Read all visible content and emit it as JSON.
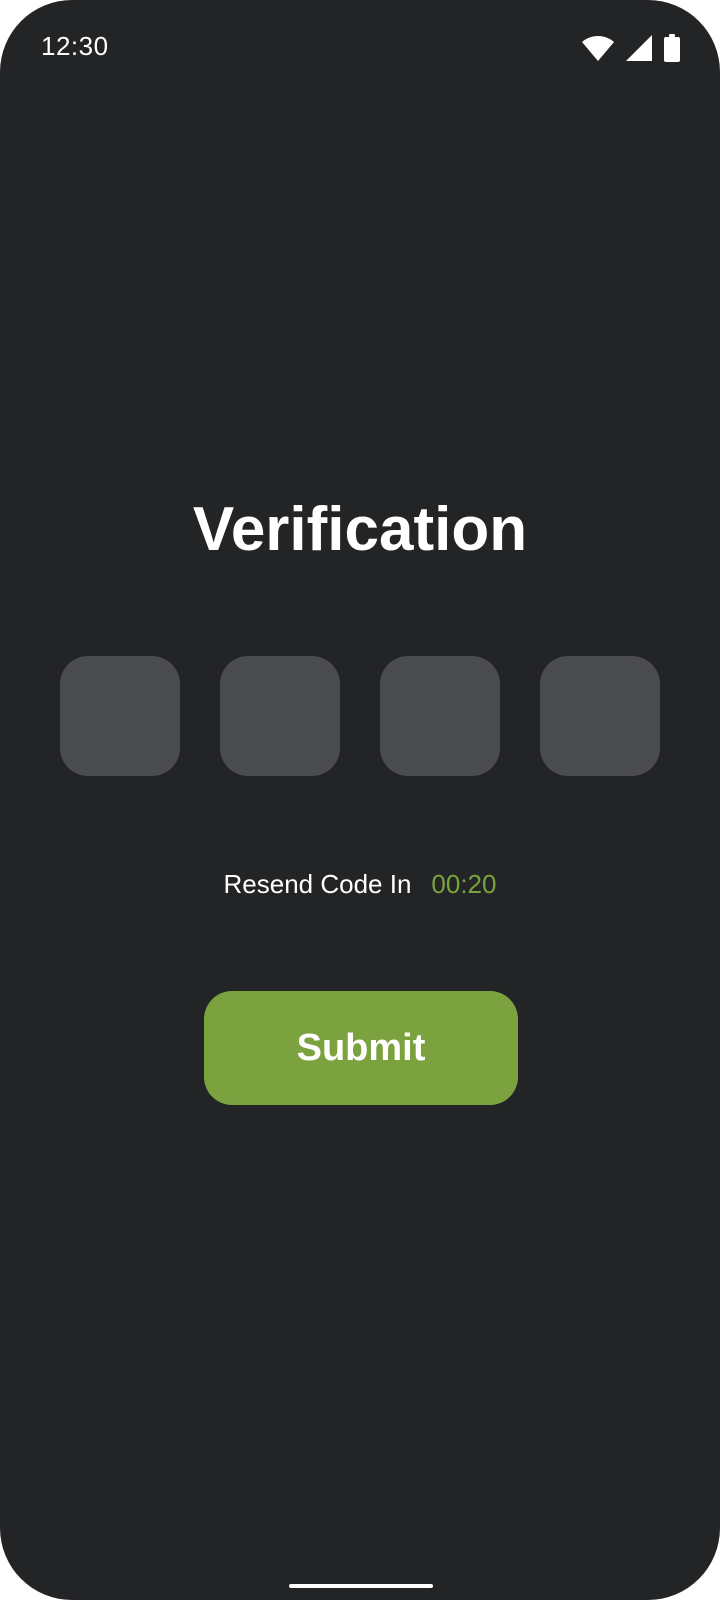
{
  "status_bar": {
    "time": "12:30",
    "icons": [
      "wifi-icon",
      "cellular-signal-icon",
      "battery-icon"
    ]
  },
  "verification": {
    "title": "Verification",
    "code_boxes": [
      "",
      "",
      "",
      ""
    ],
    "resend_label": "Resend Code In",
    "resend_timer": "00:20",
    "submit_label": "Submit"
  },
  "colors": {
    "background": "#232426",
    "box": "#4a4b4e",
    "accent": "#7ba23e",
    "text": "#ffffff"
  }
}
